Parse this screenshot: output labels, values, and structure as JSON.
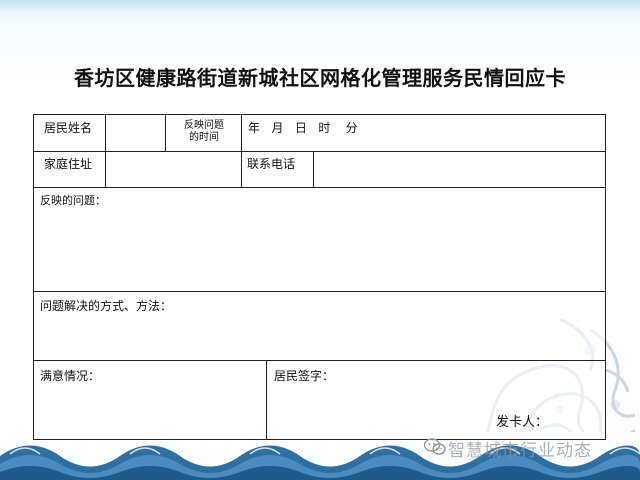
{
  "page": {
    "title": "香坊区健康路街道新城社区网格化管理服务民情回应卡"
  },
  "form": {
    "resident_name_label": "居民姓名",
    "report_time_label_line1": "反映问题",
    "report_time_label_line2": "的时间",
    "datetime_units": "年   月   日   时    分",
    "address_label": "家庭住址",
    "phone_label": "联系电话",
    "issue_label": "反映的问题：",
    "solution_label": "问题解决的方式、方法：",
    "satisfaction_label": "满意情况：",
    "signature_label": "居民签字：",
    "issuer_label": "发卡人："
  },
  "watermark": {
    "text": "智慧城市行业动态",
    "icon": "wechat-icon"
  },
  "colors": {
    "border": "#222222",
    "background_tint": "#e9f5fb",
    "watermark": "#8c96a5"
  }
}
